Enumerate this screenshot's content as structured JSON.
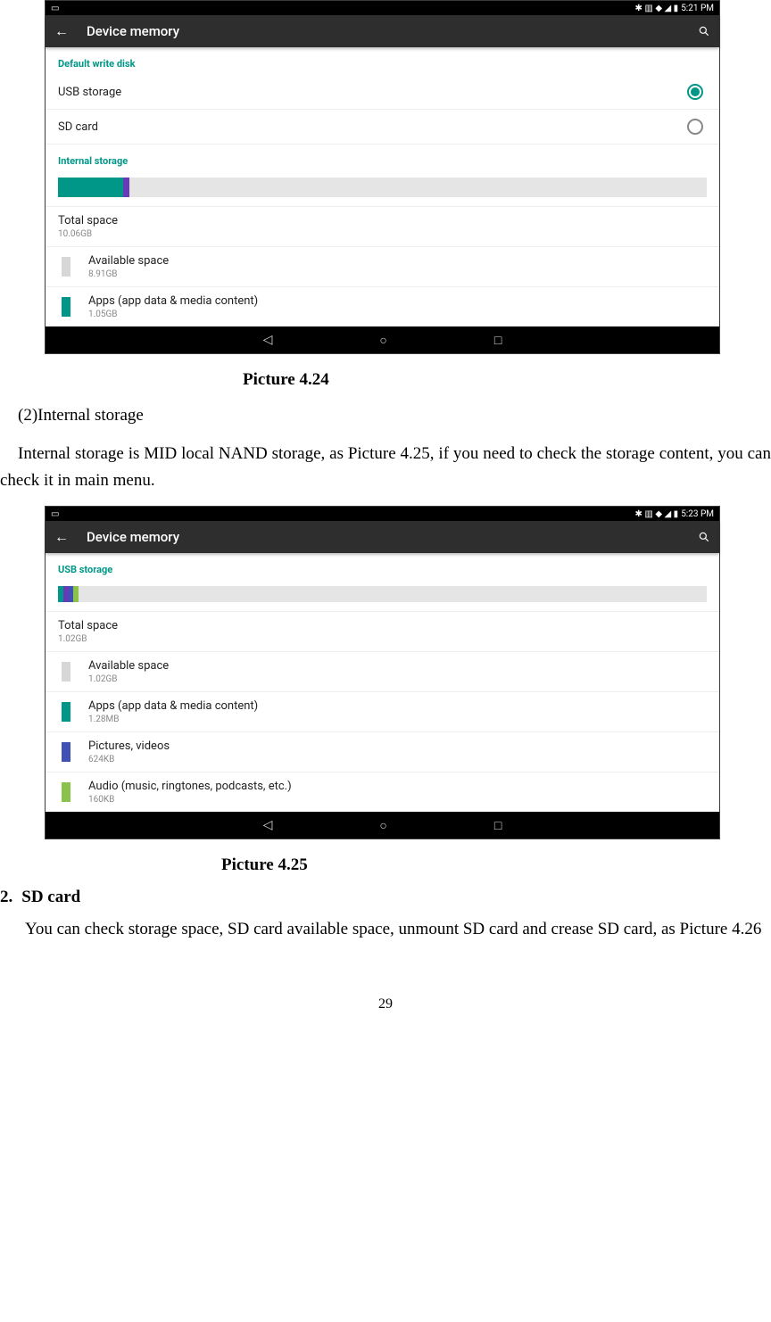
{
  "fig1": {
    "status": {
      "time": "5:21 PM",
      "icons": "✱ ▥ ◆ ◢ ▮"
    },
    "appbar": {
      "title": "Device memory"
    },
    "section1": "Default write disk",
    "options": [
      {
        "label": "USB storage",
        "checked": true
      },
      {
        "label": "SD card",
        "checked": false
      }
    ],
    "section2": "Internal storage",
    "bar_segments": [
      {
        "color": "#009688",
        "width_pct": 10
      },
      {
        "color": "#673ab7",
        "width_pct": 1
      }
    ],
    "total": {
      "title": "Total space",
      "sub": "10.06GB"
    },
    "items": [
      {
        "color": "#d7d7d7",
        "title": "Available space",
        "sub": "8.91GB"
      },
      {
        "color": "#009688",
        "title": "Apps (app data & media content)",
        "sub": "1.05GB"
      }
    ]
  },
  "caption1": "Picture 4.24",
  "para_heading": "(2)Internal storage",
  "para_body": "Internal storage is MID local NAND storage, as Picture 4.25, if you need to check the storage content, you can check it in main menu.",
  "fig2": {
    "status": {
      "time": "5:23 PM",
      "icons": "✱ ▥ ◆ ◢ ▮"
    },
    "appbar": {
      "title": "Device memory"
    },
    "section1": "USB storage",
    "bar_segments": [
      {
        "color": "#009688",
        "width_pct": 0.8
      },
      {
        "color": "#673ab7",
        "width_pct": 0.8
      },
      {
        "color": "#3f51b5",
        "width_pct": 0.8
      },
      {
        "color": "#8bc34a",
        "width_pct": 0.8
      }
    ],
    "total": {
      "title": "Total space",
      "sub": "1.02GB"
    },
    "items": [
      {
        "color": "#d7d7d7",
        "title": "Available space",
        "sub": "1.02GB"
      },
      {
        "color": "#009688",
        "title": "Apps (app data & media content)",
        "sub": "1.28MB"
      },
      {
        "color": "#3f51b5",
        "title": "Pictures, videos",
        "sub": "624KB"
      },
      {
        "color": "#8bc34a",
        "title": "Audio (music, ringtones, podcasts, etc.)",
        "sub": "160KB"
      }
    ]
  },
  "caption2": "Picture 4.25",
  "list2_num": "2.",
  "list2_title": "SD card",
  "list2_body": "You can check storage space, SD card available space, unmount SD card and crease SD card, as Picture 4.26",
  "page_number": "29"
}
